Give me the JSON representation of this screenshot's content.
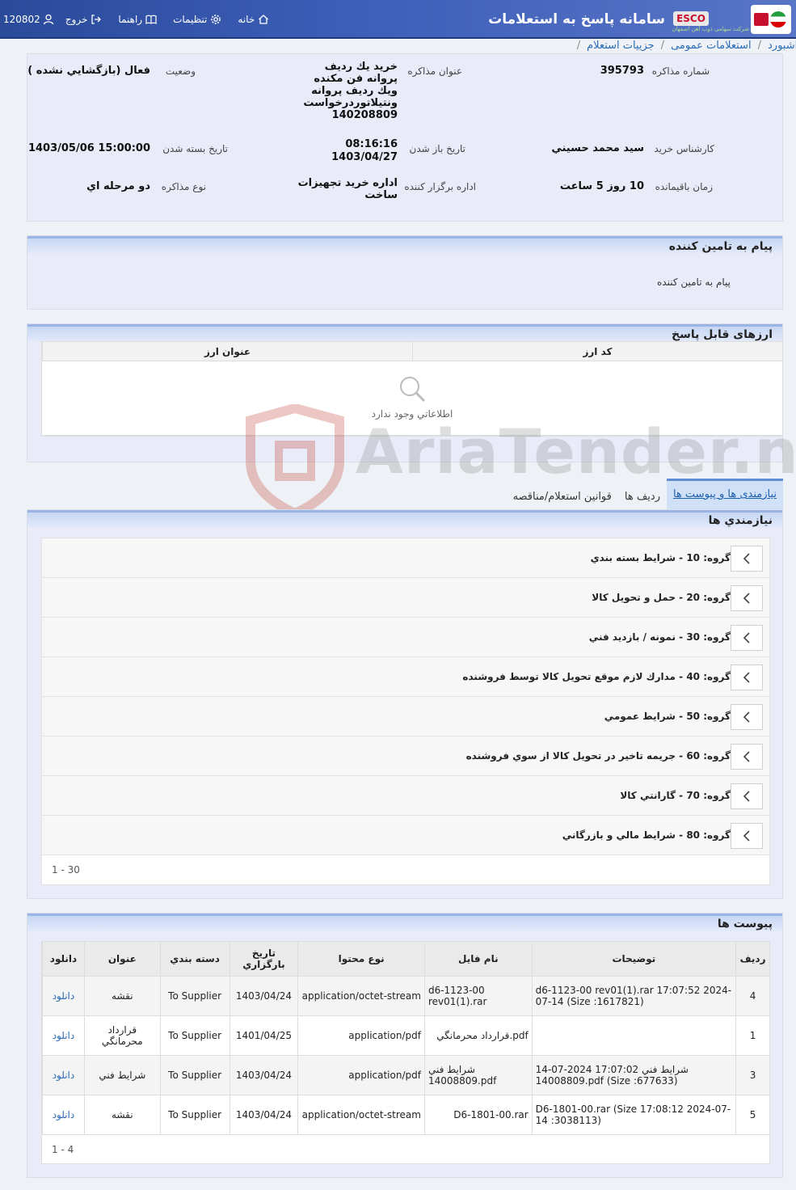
{
  "header": {
    "app_title": "سامانه پاسخ به استعلامات",
    "esco": "ESCO",
    "esco_sub": "شرکت سهامی ذوب آهن اصفهان",
    "user_id": "120802",
    "nav": {
      "logout": "خروج",
      "help": "راهنما",
      "settings": "تنظیمات",
      "home": "خانه"
    }
  },
  "breadcrumb": [
    "داشبورد",
    "استعلامات عمومی",
    "جزییات استعلام"
  ],
  "info": {
    "negotiation_number_label": "شماره مذاکره",
    "negotiation_number": "395793",
    "negotiation_title_label": "عنوان مذاکره",
    "negotiation_title": "خريد يك رديف پروانه فن مكنده ويك رديف پروانه ونتيلاتوردرخواست 140208809",
    "status_label": "وضعيت",
    "status": "فعال (بازگشايي نشده )",
    "buyer_label": "کارشناس خريد",
    "buyer": "سيد محمد حسيني",
    "open_date_label": "تاريخ باز شدن",
    "open_date_time": "08:16:16",
    "open_date": "1403/04/27",
    "close_date_label": "تاريخ بسته شدن",
    "close_date": "1403/05/06 15:00:00",
    "remaining_label": "زمان باقيمانده",
    "remaining": "10 روز 5 ساعت",
    "org_label": "اداره برگزار کننده",
    "org": "اداره خريد تجهيزات ساخت",
    "type_label": "نوع مذاکره",
    "type": "دو مرحله اي"
  },
  "supplier_message": {
    "title": "پيام به تامين كننده",
    "text": "پيام به تامين کننده"
  },
  "currencies": {
    "title": "ارزهای قابل پاسخ",
    "columns": [
      "کد ارز",
      "عنوان ارز"
    ],
    "empty": "اطلاعاتي وجود ندارد"
  },
  "watermark": "AriaTender.neT",
  "tabs": [
    "نیازمندی ها و پیوست ها",
    "رديف ها",
    "قوانين استعلام/مناقصه"
  ],
  "requirements": {
    "title": "نيازمندي ها",
    "items": [
      "گروه: 10 - شرايط بسته بندي",
      "گروه: 20 - حمل و تحويل كالا",
      "گروه: 30 - نمونه / بازديد فني",
      "گروه: 40 - مدارك لازم موقع تحويل كالا توسط فروشنده",
      "گروه: 50 - شرايط عمومي",
      "گروه: 60 - جريمه تاخير در تحويل كالا از سوي فروشنده",
      "گروه: 70 - گارانتي كالا",
      "گروه: 80 - شرايط مالي و بازرگاني"
    ],
    "pager": "1 - 30"
  },
  "attachments": {
    "title": "پيوست ها",
    "columns": [
      "رديف",
      "توضيحات",
      "نام فایل",
      "نوع محتوا",
      "تاريخ بارگزاري",
      "دسته بندي",
      "عنوان",
      "دانلود"
    ],
    "rows": [
      {
        "row": "4",
        "desc": "d6-1123-00 rev01(1).rar 17:07:52 2024-07-14 (Size :1617821)",
        "file": "d6-1123-00 rev01(1).rar",
        "type": "application/octet-stream",
        "date": "1403/04/24",
        "cat": "To Supplier",
        "title": "نقشه",
        "dl": "دانلود"
      },
      {
        "row": "1",
        "desc": "",
        "file": "قرارداد محرمانگي.pdf",
        "type": "application/pdf",
        "date": "1401/04/25",
        "cat": "To Supplier",
        "title": "قرارداد محرمانگي",
        "dl": "دانلود"
      },
      {
        "row": "3",
        "desc": "شرايط فني 17:07:02 2024-07-14 14008809.pdf (Size :677633)",
        "file": "شرايط فني 14008809.pdf",
        "type": "application/pdf",
        "date": "1403/04/24",
        "cat": "To Supplier",
        "title": "شرايط فني",
        "dl": "دانلود"
      },
      {
        "row": "5",
        "desc": "D6-1801-00.rar (Size 17:08:12 2024-07-14 :3038113)",
        "file": "D6-1801-00.rar",
        "type": "application/octet-stream",
        "date": "1403/04/24",
        "cat": "To Supplier",
        "title": "نقشه",
        "dl": "دانلود"
      }
    ],
    "pager": "1 - 4"
  },
  "colors": {
    "header": "#2a4a9a",
    "accent": "#2a6bb8",
    "panel": "#e9ecf8"
  }
}
